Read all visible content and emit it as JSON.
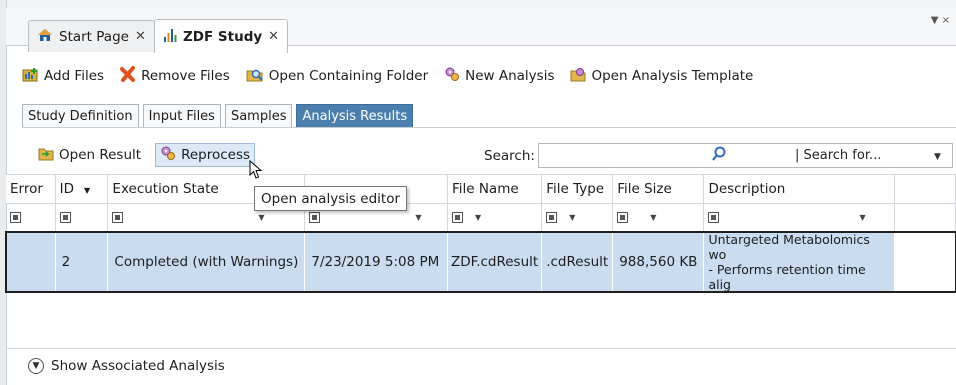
{
  "tabs": [
    {
      "label": "Start Page",
      "icon": "home-icon",
      "close": "✕",
      "active": false
    },
    {
      "label": "ZDF Study",
      "icon": "chart-icon",
      "close": "✕",
      "active": true
    }
  ],
  "toolbar": {
    "add_files": "Add Files",
    "remove_files": "Remove Files",
    "open_containing_folder": "Open Containing Folder",
    "new_analysis": "New Analysis",
    "open_analysis_template": "Open Analysis Template"
  },
  "subtabs": [
    "Study Definition",
    "Input Files",
    "Samples",
    "Analysis Results"
  ],
  "results_toolbar": {
    "open_result": "Open Result",
    "reprocess": "Reprocess",
    "search_label": "Search:",
    "search_placeholder": "| Search for..."
  },
  "tooltip": "Open analysis editor",
  "grid": {
    "columns": [
      "Error",
      "ID",
      "Execution State",
      "",
      "File Name",
      "File Type",
      "File Size",
      "Description"
    ],
    "rows": [
      {
        "error": "",
        "id": "2",
        "execution_state": "Completed (with Warnings)",
        "date": "7/23/2019 5:08 PM",
        "file_name": "ZDF.cdResult",
        "file_type": ".cdResult",
        "file_size": "988,560 KB",
        "description_line1": "Untargeted Metabolomics wo",
        "description_line2": "- Performs retention time alig"
      }
    ]
  },
  "footer": {
    "show_associated": "Show Associated Analysis"
  },
  "colors": {
    "accent": "#4a7fae",
    "selected_row": "#c9dcf0"
  }
}
